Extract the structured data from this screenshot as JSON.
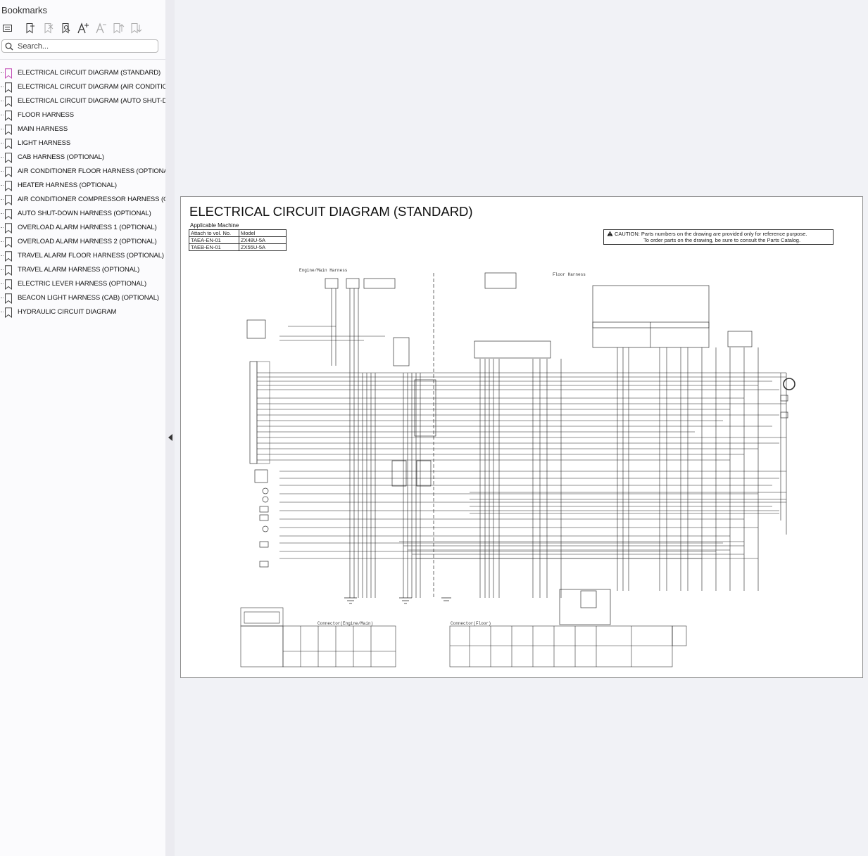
{
  "sidebar": {
    "title": "Bookmarks",
    "toolbar": [
      {
        "name": "expand-all-bookmarks-icon"
      },
      {
        "name": "add-bookmark-icon"
      },
      {
        "name": "delete-bookmark-icon"
      },
      {
        "name": "bookmark-properties-icon"
      },
      {
        "name": "increase-text-size-icon"
      },
      {
        "name": "decrease-text-size-icon"
      },
      {
        "name": "move-bookmark-up-icon"
      },
      {
        "name": "move-bookmark-down-icon"
      }
    ],
    "search_placeholder": "Search...",
    "items": [
      {
        "label": "ELECTRICAL CIRCUIT DIAGRAM (STANDARD)",
        "active": true
      },
      {
        "label": "ELECTRICAL CIRCUIT DIAGRAM  (AIR CONDITIONER) (OPTIONAL)",
        "active": false
      },
      {
        "label": "ELECTRICAL CIRCUIT DIAGRAM (AUTO SHUT-DOWN) (OPTIONAL)",
        "active": false
      },
      {
        "label": "FLOOR HARNESS",
        "active": false
      },
      {
        "label": "MAIN HARNESS",
        "active": false
      },
      {
        "label": "LIGHT HARNESS",
        "active": false
      },
      {
        "label": "CAB HARNESS (OPTIONAL)",
        "active": false
      },
      {
        "label": "AIR CONDITIONER FLOOR HARNESS (OPTIONAL)",
        "active": false
      },
      {
        "label": "HEATER HARNESS (OPTIONAL)",
        "active": false
      },
      {
        "label": "AIR CONDITIONER COMPRESSOR HARNESS (OPTIONAL)",
        "active": false
      },
      {
        "label": "AUTO SHUT-DOWN HARNESS (OPTIONAL)",
        "active": false
      },
      {
        "label": "OVERLOAD ALARM HARNESS 1 (OPTIONAL)",
        "active": false
      },
      {
        "label": "OVERLOAD ALARM HARNESS 2 (OPTIONAL)",
        "active": false
      },
      {
        "label": "TRAVEL ALARM FLOOR HARNESS (OPTIONAL)",
        "active": false
      },
      {
        "label": "TRAVEL ALARM  HARNESS (OPTIONAL)",
        "active": false
      },
      {
        "label": "ELECTRIC LEVER HARNESS (OPTIONAL)",
        "active": false
      },
      {
        "label": "BEACON LIGHT HARNESS (CAB) (OPTIONAL)",
        "active": false
      },
      {
        "label": "HYDRAULIC CIRCUIT DIAGRAM",
        "active": false
      }
    ]
  },
  "document": {
    "title": "ELECTRICAL CIRCUIT DIAGRAM (STANDARD)",
    "applicable_machine_label": "Applicable Machine",
    "table_header": [
      "Attach to vol. No.",
      "Model"
    ],
    "table_rows": [
      [
        "TAEA-EN-01",
        "ZX48U-5A"
      ],
      [
        "TAEB-EN-01",
        "ZX55U-5A"
      ]
    ],
    "caution_line1": "CAUTION: Parts numbers on the drawing are provided only for reference purpose.",
    "caution_line2": "To order parts on the drawing, be sure to consult the Parts Catalog.",
    "schematic_labels": {
      "engine_main": "Engine/Main Harness",
      "floor": "Floor Harness",
      "connector_engine": "Connector(Engine/Main)",
      "connector_floor": "Connector(Floor)"
    }
  },
  "colors": {
    "active_bookmark": "#c34fb6",
    "bookmark": "#444444",
    "accent_border": "#8e8e8e"
  }
}
